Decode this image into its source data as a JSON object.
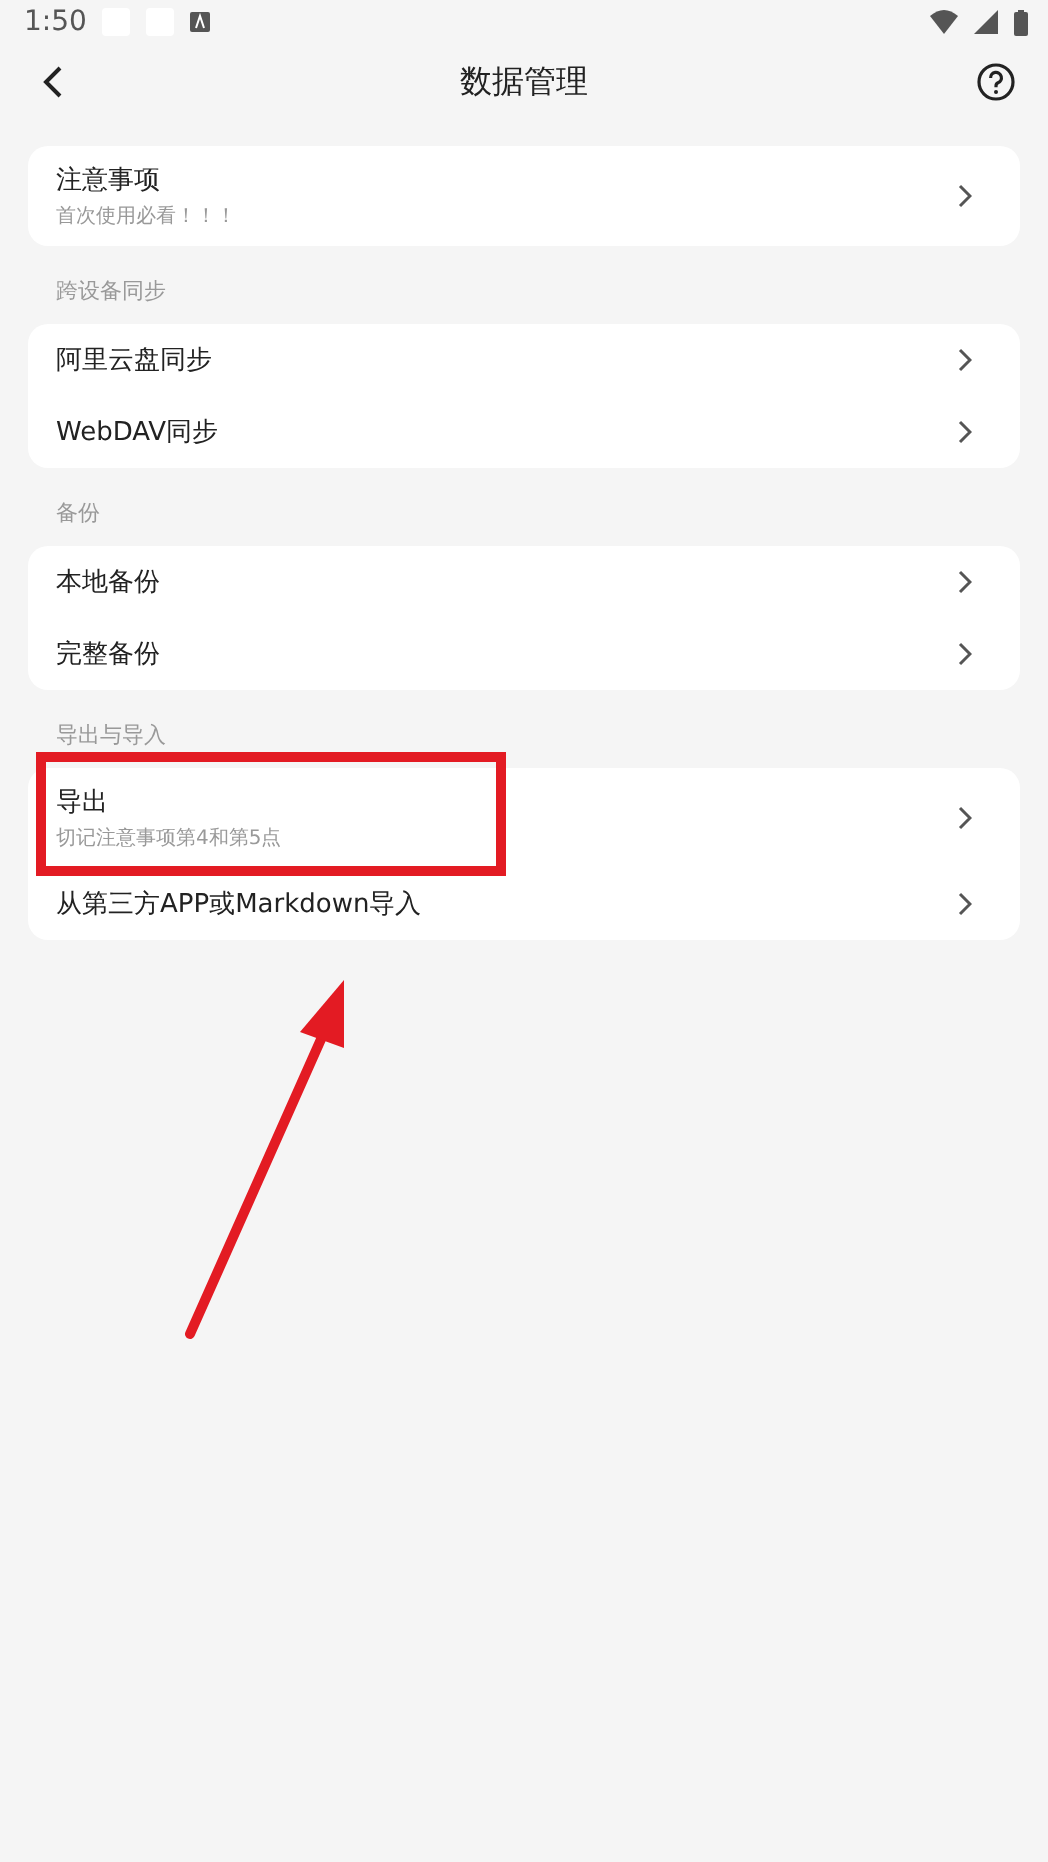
{
  "status_bar": {
    "time": "1:50"
  },
  "header": {
    "title": "数据管理"
  },
  "sections": [
    {
      "items": [
        {
          "title": "注意事项",
          "subtitle": "首次使用必看！！！",
          "highlighted": false
        }
      ]
    },
    {
      "label": "跨设备同步",
      "items": [
        {
          "title": "阿里云盘同步",
          "highlighted": false
        },
        {
          "title": "WebDAV同步",
          "highlighted": false
        }
      ]
    },
    {
      "label": "备份",
      "items": [
        {
          "title": "本地备份",
          "highlighted": false
        },
        {
          "title": "完整备份",
          "highlighted": false
        }
      ]
    },
    {
      "label": "导出与导入",
      "items": [
        {
          "title": "导出",
          "subtitle": "切记注意事项第4和第5点",
          "highlighted": true
        },
        {
          "title": "从第三方APP或Markdown导入",
          "highlighted": false
        }
      ]
    }
  ],
  "pointer_arrow": true
}
